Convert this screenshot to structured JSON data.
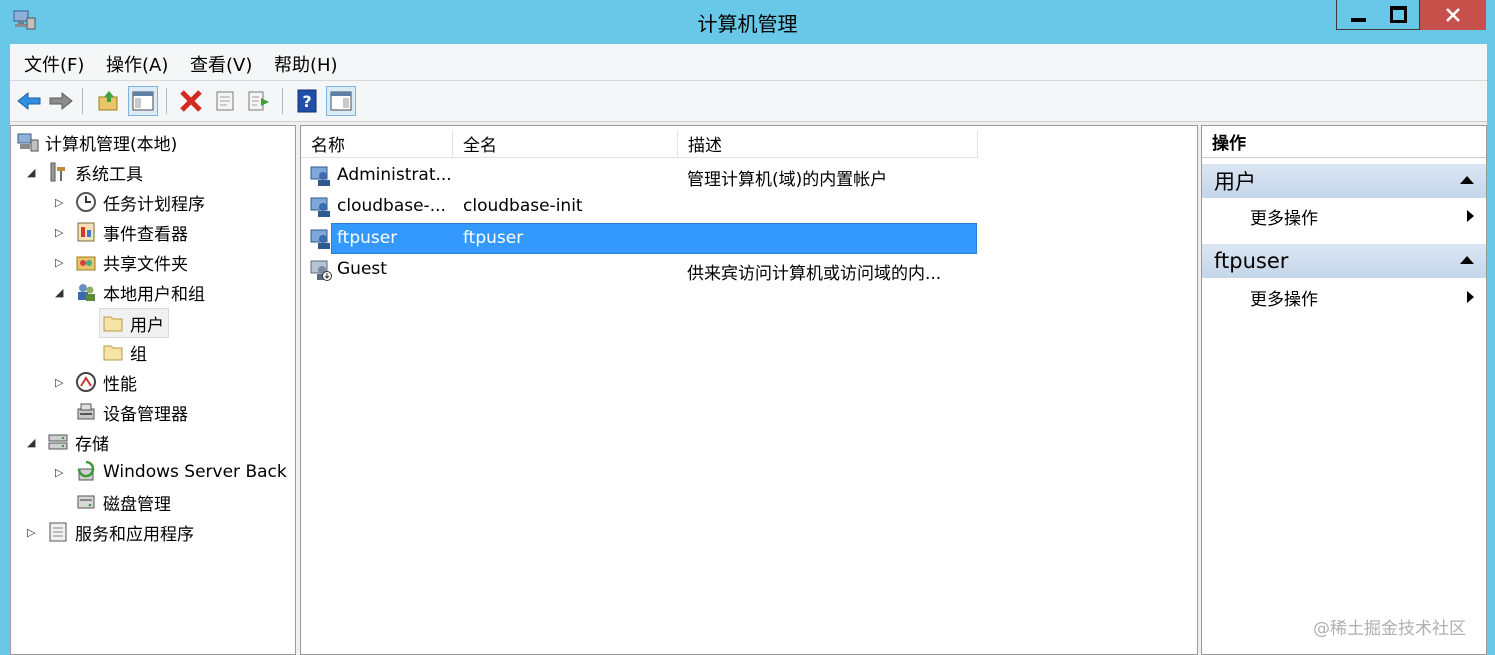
{
  "window": {
    "title": "计算机管理"
  },
  "menu": [
    "文件(F)",
    "操作(A)",
    "查看(V)",
    "帮助(H)"
  ],
  "toolbar": {
    "buttons": [
      "back-icon",
      "forward-icon",
      "up-folder-icon",
      "show-hide-tree-icon",
      "delete-icon",
      "properties-icon",
      "export-list-icon",
      "help-icon",
      "show-hide-action-pane-icon"
    ]
  },
  "tree": [
    {
      "label": "计算机管理(本地)",
      "icon": "computer-management-icon",
      "arrow": ""
    },
    {
      "label": "系统工具",
      "icon": "system-tools-icon",
      "arrow": "◢"
    },
    {
      "label": "任务计划程序",
      "icon": "task-scheduler-icon",
      "arrow": "▷"
    },
    {
      "label": "事件查看器",
      "icon": "event-viewer-icon",
      "arrow": "▷"
    },
    {
      "label": "共享文件夹",
      "icon": "shared-folders-icon",
      "arrow": "▷"
    },
    {
      "label": "本地用户和组",
      "icon": "local-users-groups-icon",
      "arrow": "◢"
    },
    {
      "label": "用户",
      "icon": "folder-icon",
      "arrow": ""
    },
    {
      "label": "组",
      "icon": "folder-icon",
      "arrow": ""
    },
    {
      "label": "性能",
      "icon": "performance-icon",
      "arrow": "▷"
    },
    {
      "label": "设备管理器",
      "icon": "device-manager-icon",
      "arrow": ""
    },
    {
      "label": "存储",
      "icon": "storage-icon",
      "arrow": "◢"
    },
    {
      "label": "Windows Server Back",
      "icon": "windows-server-backup-icon",
      "arrow": "▷"
    },
    {
      "label": "磁盘管理",
      "icon": "disk-management-icon",
      "arrow": ""
    },
    {
      "label": "服务和应用程序",
      "icon": "services-applications-icon",
      "arrow": "▷"
    }
  ],
  "list": {
    "columns": [
      "名称",
      "全名",
      "描述"
    ],
    "rows": [
      {
        "name": "Administrat...",
        "fullname": "",
        "description": "管理计算机(域)的内置帐户"
      },
      {
        "name": "cloudbase-...",
        "fullname": "cloudbase-init",
        "description": ""
      },
      {
        "name": "ftpuser",
        "fullname": "ftpuser",
        "description": ""
      },
      {
        "name": "Guest",
        "fullname": "",
        "description": "供来宾访问计算机或访问域的内..."
      }
    ]
  },
  "actions": {
    "title": "操作",
    "sections": [
      {
        "header": "用户",
        "item": "更多操作"
      },
      {
        "header": "ftpuser",
        "item": "更多操作"
      }
    ]
  },
  "watermark": "@稀土掘金技术社区",
  "colors": {
    "titlebar": "#69c8e8",
    "selection": "#3399ff",
    "close_button": "#c7504b",
    "delete": "#d42b20",
    "help": "#1f4fa8"
  }
}
